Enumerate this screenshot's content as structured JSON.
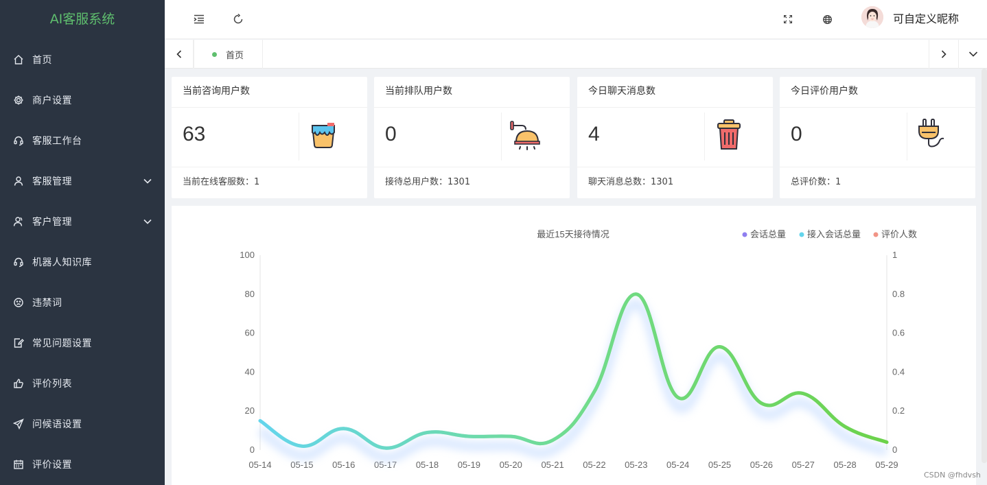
{
  "app": {
    "title": "AI客服系统"
  },
  "sidebar": {
    "items": [
      {
        "label": "首页",
        "icon": "home-icon"
      },
      {
        "label": "商户设置",
        "icon": "gear-icon"
      },
      {
        "label": "客服工作台",
        "icon": "headset-icon"
      },
      {
        "label": "客服管理",
        "icon": "user-icon",
        "expandable": true
      },
      {
        "label": "客户管理",
        "icon": "users-icon",
        "expandable": true
      },
      {
        "label": "机器人知识库",
        "icon": "robot-icon"
      },
      {
        "label": "违禁词",
        "icon": "frown-icon"
      },
      {
        "label": "常见问题设置",
        "icon": "edit-doc-icon"
      },
      {
        "label": "评价列表",
        "icon": "thumbs-up-icon"
      },
      {
        "label": "问候语设置",
        "icon": "send-icon"
      },
      {
        "label": "评价设置",
        "icon": "calendar-icon"
      }
    ]
  },
  "header": {
    "nickname": "可自定义昵称"
  },
  "tabs": {
    "active_label": "首页"
  },
  "stats": [
    {
      "title": "当前咨询用户数",
      "value": "63",
      "footer": "当前在线客服数：1",
      "icon": "paint-bucket-icon"
    },
    {
      "title": "当前排队用户数",
      "value": "0",
      "footer": "接待总用户数：1301",
      "icon": "shower-icon"
    },
    {
      "title": "今日聊天消息数",
      "value": "4",
      "footer": "聊天消息总数：1301",
      "icon": "trash-bin-icon"
    },
    {
      "title": "今日评价用户数",
      "value": "0",
      "footer": "总评价数：1",
      "icon": "plug-icon"
    }
  ],
  "chart_data": {
    "type": "line",
    "title": "最近15天接待情况",
    "categories": [
      "05-14",
      "05-15",
      "05-16",
      "05-17",
      "05-18",
      "05-19",
      "05-20",
      "05-21",
      "05-22",
      "05-23",
      "05-24",
      "05-25",
      "05-26",
      "05-27",
      "05-28",
      "05-29"
    ],
    "y_left": {
      "min": 0,
      "max": 100,
      "ticks": [
        0,
        20,
        40,
        60,
        80,
        100
      ]
    },
    "y_right": {
      "min": 0,
      "max": 1,
      "ticks": [
        "0",
        "0.2",
        "0.4",
        "0.6",
        "0.8",
        "1"
      ]
    },
    "series": [
      {
        "name": "会话总量",
        "color": "#8f7ff0",
        "values": [
          15,
          2,
          11,
          1,
          9,
          7,
          7,
          5,
          30,
          80,
          27,
          53,
          24,
          29,
          12,
          4
        ]
      },
      {
        "name": "接入会话总量",
        "color": "#64d5ec",
        "values": [
          15,
          2,
          11,
          1,
          9,
          7,
          7,
          5,
          30,
          80,
          27,
          53,
          24,
          29,
          12,
          4
        ]
      },
      {
        "name": "评价人数",
        "color": "#f19486",
        "axis": "right",
        "values": [
          0,
          0,
          0,
          0,
          0,
          0,
          0,
          0,
          0,
          0,
          0,
          0,
          0,
          0,
          0,
          0
        ]
      }
    ],
    "legend_position": "top-right",
    "grid": false
  },
  "watermark": "CSDN @fhdvsh"
}
